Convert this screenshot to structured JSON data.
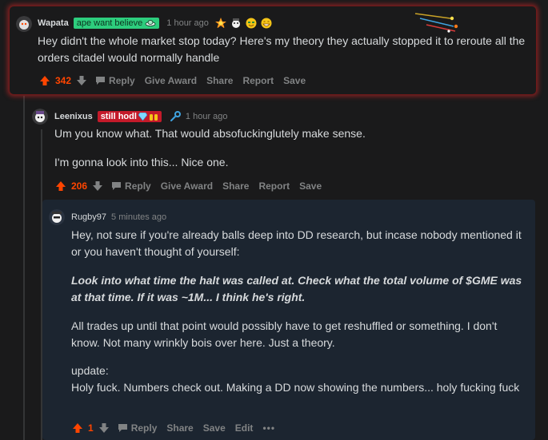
{
  "colors": {
    "background": "#1a1a1b",
    "text": "#d7dadc",
    "muted": "#818384",
    "upvote": "#ff4500",
    "highlight_border": "#d22828",
    "nested_panel": "#1c2530"
  },
  "comments": [
    {
      "username": "Wapata",
      "flair": "ape want believe",
      "time": "1 hour ago",
      "body": [
        "Hey didn't the whole market stop today? Here's my theory they actually stopped it to reroute all the orders citadel would normally handle"
      ],
      "score": "342",
      "actions": [
        "Reply",
        "Give Award",
        "Share",
        "Report",
        "Save"
      ],
      "awards": [
        "explosion-award-icon",
        "wholesome-award-icon",
        "money-face-award-icon",
        "grin-award-icon"
      ]
    },
    {
      "username": "Leenixus",
      "flair": "still hodl",
      "time": "1 hour ago",
      "body": [
        "Um you know what. That would absofuckinglutely make sense.",
        "I'm gonna look into this... Nice one."
      ],
      "score": "206",
      "actions": [
        "Reply",
        "Give Award",
        "Share",
        "Report",
        "Save"
      ]
    },
    {
      "username": "Rugby97",
      "time": "5 minutes ago",
      "body_p1": "Hey, not sure if you're already balls deep into DD research, but incase nobody mentioned it or you haven't thought of yourself:",
      "body_p2": "Look into what time the halt was called at. Check what the total volume of $GME was at that time. If it was ~1M... I think he's right.",
      "body_p3": "All trades up until that point would possibly have to get reshuffled or something. I don't know. Not many wrinkly bois over here. Just a theory.",
      "body_p4a": "update:",
      "body_p4b": "Holy fuck. Numbers check out. Making a DD now showing the numbers... holy fucking fuck",
      "score": "1",
      "actions": [
        "Reply",
        "Share",
        "Save",
        "Edit",
        "•••"
      ]
    }
  ]
}
